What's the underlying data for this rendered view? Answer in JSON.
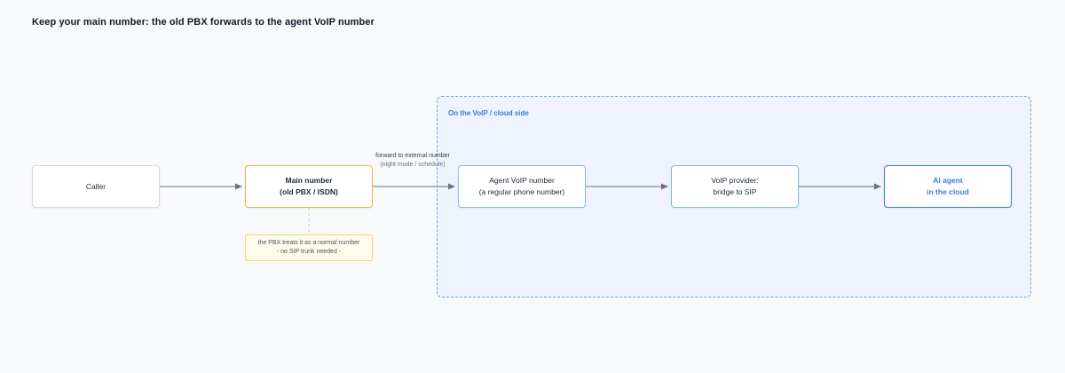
{
  "title": "Keep your main number: the old PBX forwards to the agent VoIP number",
  "cloud_group": {
    "label": "On the VoIP / cloud side"
  },
  "nodes": {
    "caller": {
      "line1": "Caller"
    },
    "main": {
      "line1": "Main number",
      "line2": "(old PBX / ISDN)"
    },
    "agent_voip": {
      "line1": "Agent VoIP number",
      "line2": "(a regular phone number)"
    },
    "provider": {
      "line1": "VoIP provider:",
      "line2": "bridge to SIP"
    },
    "ai_agent": {
      "line1": "AI agent",
      "line2": "in the cloud"
    }
  },
  "edge_label": {
    "line1": "forward to external number",
    "line2": "(night mode / schedule)"
  },
  "note": {
    "line1": "the PBX treats it as a normal number",
    "line2": "- no SIP trunk needed -"
  },
  "colors": {
    "accent_blue": "#3b7dd8",
    "accent_orange": "#f2b53a",
    "note_bg": "#fffbea",
    "group_bg": "#eef3fd"
  }
}
